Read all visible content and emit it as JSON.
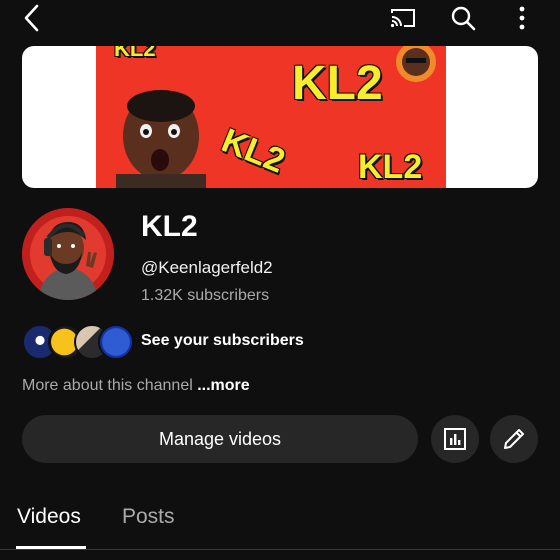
{
  "topbar": {
    "back_icon": "chevron-left-icon",
    "cast_icon": "cast-icon",
    "search_icon": "search-icon",
    "more_icon": "more-vertical-icon"
  },
  "banner": {
    "text_1": "KL2",
    "text_2": "KL2",
    "text_3": "KL2",
    "text_4": "KL2"
  },
  "channel": {
    "name": "KL2",
    "handle": "@Keenlagerfeld2",
    "subscribers": "1.32K subscribers"
  },
  "subscribers_preview": {
    "label": "See your subscribers"
  },
  "about": {
    "text": "More about this channel ",
    "more": "...more"
  },
  "actions": {
    "manage_label": "Manage videos",
    "analytics_icon": "analytics-icon",
    "edit_icon": "pencil-icon"
  },
  "tabs": [
    {
      "label": "Videos",
      "active": true
    },
    {
      "label": "Posts",
      "active": false
    }
  ],
  "colors": {
    "background": "#0f0f0f",
    "button": "#272727",
    "banner_red": "#ef3626",
    "banner_text": "#f6ee2d",
    "muted_text": "#aaaaaa"
  }
}
